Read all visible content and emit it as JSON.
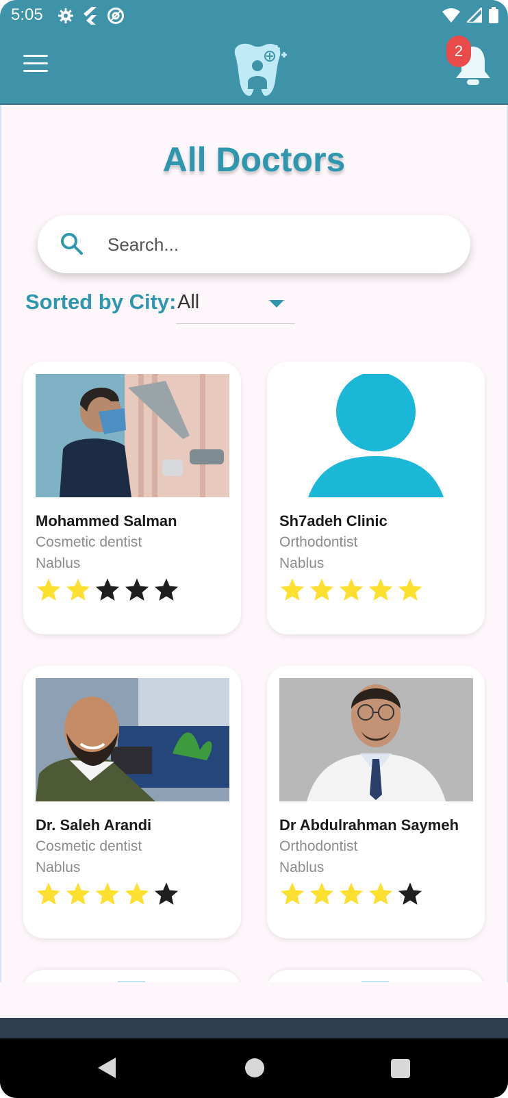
{
  "status_bar": {
    "time": "5:05",
    "icons_left": [
      "gear-icon",
      "flutter-icon",
      "at-icon"
    ],
    "icons_right": [
      "wifi-icon",
      "signal-icon",
      "battery-icon"
    ]
  },
  "app_bar": {
    "menu_icon": "hamburger-menu-icon",
    "logo_icon": "tooth-logo-icon",
    "notification_icon": "bell-icon",
    "notification_count": "2"
  },
  "page": {
    "title": "All Doctors"
  },
  "search": {
    "placeholder": "Search..."
  },
  "filter": {
    "label": "Sorted by City:",
    "selected_city": "All"
  },
  "doctors": [
    {
      "name": "Mohammed Salman",
      "specialty": "Cosmetic dentist",
      "city": "Nablus",
      "rating": 2,
      "max_rating": 5,
      "photo": "dentist-photo-masked"
    },
    {
      "name": "Sh7adeh Clinic",
      "specialty": "Orthodontist",
      "city": "Nablus",
      "rating": 5,
      "max_rating": 5,
      "photo": "default-avatar"
    },
    {
      "name": "Dr. Saleh Arandi",
      "specialty": "Cosmetic dentist",
      "city": "Nablus",
      "rating": 4,
      "max_rating": 5,
      "photo": "dentist-photo-smiling"
    },
    {
      "name": "Dr Abdulrahman Saymeh",
      "specialty": "Orthodontist",
      "city": "Nablus",
      "rating": 4,
      "max_rating": 5,
      "photo": "dentist-photo-whitecoat"
    }
  ],
  "colors": {
    "primary": "#3f93a8",
    "title": "#2f97ad",
    "star_filled": "#fde02f",
    "star_empty": "#1f1f1f",
    "avatar": "#1bb7d6",
    "badge": "#e94a4a"
  },
  "nav_bar": {
    "back": "back-icon",
    "home": "home-icon",
    "recents": "recents-icon"
  }
}
